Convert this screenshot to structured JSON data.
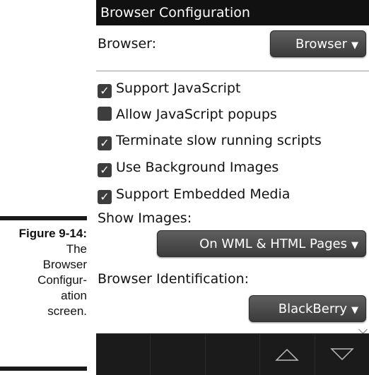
{
  "caption": {
    "figure_label": "Figure 9-14:",
    "text_lines": [
      "The",
      "Browser",
      "Configur-",
      "ation",
      "screen."
    ]
  },
  "screen": {
    "title": "Browser Configuration",
    "browser": {
      "label": "Browser:",
      "value": "Browser"
    },
    "checkboxes": [
      {
        "label": "Support JavaScript",
        "checked": true
      },
      {
        "label": "Allow JavaScript popups",
        "checked": false
      },
      {
        "label": "Terminate slow running scripts",
        "checked": true
      },
      {
        "label": "Use Background Images",
        "checked": true
      },
      {
        "label": "Support Embedded Media",
        "checked": true
      }
    ],
    "show_images": {
      "label": "Show Images:",
      "value": "On WML & HTML Pages"
    },
    "browser_identification": {
      "label": "Browser Identification:",
      "value": "BlackBerry"
    },
    "dropdown_arrow": "▼",
    "check_glyph": "✓",
    "nav": {
      "up_icon": "triangle-up-icon",
      "down_icon": "triangle-down-icon"
    }
  },
  "colors": {
    "titlebar_bg": "#111111",
    "dropdown_bg": "#4a4a4a",
    "bottombar_bg": "#1b1b1b"
  }
}
